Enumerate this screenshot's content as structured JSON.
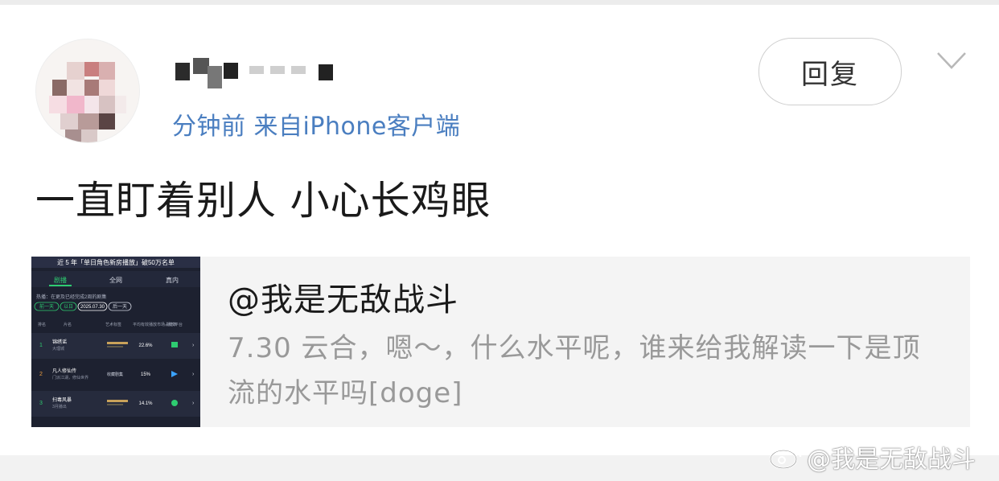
{
  "comment": {
    "meta_text": "分钟前 来自iPhone客户端",
    "reply_label": "回复",
    "text": "一直盯着别人  小心长鸡眼"
  },
  "quote": {
    "author": "@我是无敌战斗",
    "text": "7.30 云合，嗯～，什么水平呢，谁来给我解读一下是顶流的水平吗[doge]"
  },
  "thumbnail": {
    "banner": "近 5 年「单日角色新房播放」破50万名单",
    "tabs": [
      "剧播",
      "全网",
      "真内"
    ],
    "subtitle": "热播：在更及已经完成2周的剧集",
    "date_chips": [
      "前一天",
      "以日",
      "2025.07.30",
      "后一天"
    ],
    "headers": [
      "排名",
      "片名",
      "艺术标签",
      "平均有效播放市场占有率",
      "播放平台"
    ],
    "rows": [
      {
        "rank": "1",
        "title": "锦绣谣",
        "sub": "大理城",
        "share": "22.6%"
      },
      {
        "rank": "2",
        "title": "凡人修仙传",
        "sub": "门派江湖，修仙世界",
        "share": "15%",
        "label": "收藏剧集"
      },
      {
        "rank": "3",
        "title": "扫毒风暴",
        "sub": "3月播出",
        "share": "14.1%"
      }
    ]
  },
  "watermark": {
    "text": "@我是无敌战斗"
  },
  "colors": {
    "link_blue": "#4a7ec0",
    "thumb_bg": "#1d2130",
    "thumb_accent": "#2ecc71"
  }
}
